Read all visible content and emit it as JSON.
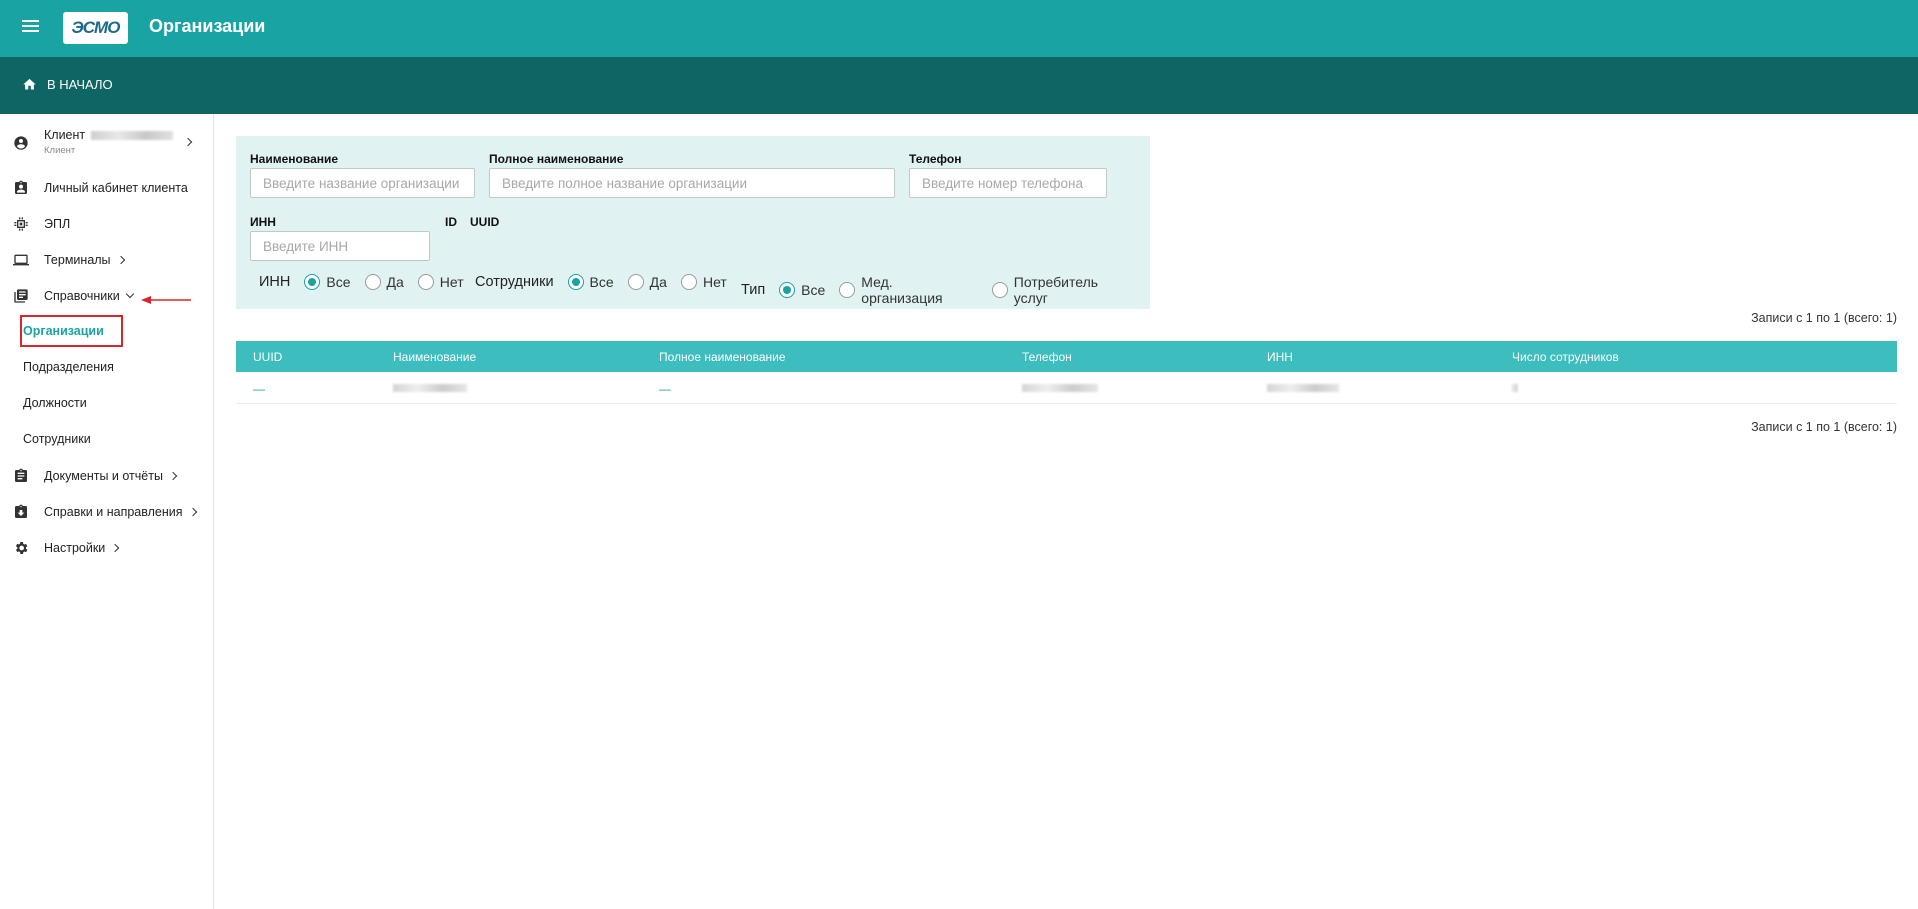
{
  "header": {
    "title": "Организации",
    "logo_text": "ЭСМО",
    "home_label": "В НАЧАЛО",
    "brand_color": "#1aa3a3",
    "dark_color": "#0f6464"
  },
  "sidebar": {
    "client": {
      "label": "Клиент",
      "sublabel": "Клиент"
    },
    "items": [
      {
        "label": "Личный кабинет клиента",
        "icon": "account-box-icon"
      },
      {
        "label": "ЭПЛ",
        "icon": "chip-icon"
      },
      {
        "label": "Терминалы",
        "icon": "laptop-icon"
      },
      {
        "label": "Справочники",
        "icon": "library-icon"
      },
      {
        "label": "Документы и отчёты",
        "icon": "clipboard-icon"
      },
      {
        "label": "Справки и направления",
        "icon": "clipboard-download-icon"
      },
      {
        "label": "Настройки",
        "icon": "gear-icon"
      }
    ],
    "subitems": [
      {
        "label": "Организации",
        "active": true
      },
      {
        "label": "Подразделения",
        "active": false
      },
      {
        "label": "Должности",
        "active": false
      },
      {
        "label": "Сотрудники",
        "active": false
      }
    ]
  },
  "filters": {
    "name": {
      "label": "Наименование",
      "placeholder": "Введите название организации"
    },
    "full_name": {
      "label": "Полное наименование",
      "placeholder": "Введите полное название организации"
    },
    "phone": {
      "label": "Телефон",
      "placeholder": "Введите номер телефона"
    },
    "inn": {
      "label": "ИНН",
      "placeholder": "Введите ИНН"
    },
    "id_label": "ID",
    "uuid_label": "UUID",
    "groups": [
      {
        "label": "ИНН",
        "options": [
          "Все",
          "Да",
          "Нет"
        ],
        "selected": "Все"
      },
      {
        "label": "Сотрудники",
        "options": [
          "Все",
          "Да",
          "Нет"
        ],
        "selected": "Все"
      },
      {
        "label": "Тип",
        "options": [
          "Все",
          "Мед. организация",
          "Потребитель услуг"
        ],
        "selected": "Все"
      }
    ]
  },
  "table": {
    "records_label": "Записи с 1 по 1 (всего: 1)",
    "columns": [
      "UUID",
      "Наименование",
      "Полное наименование",
      "Телефон",
      "ИНН",
      "Число сотрудников"
    ],
    "rows": [
      {
        "uuid": "—",
        "full_name": "—"
      }
    ]
  }
}
